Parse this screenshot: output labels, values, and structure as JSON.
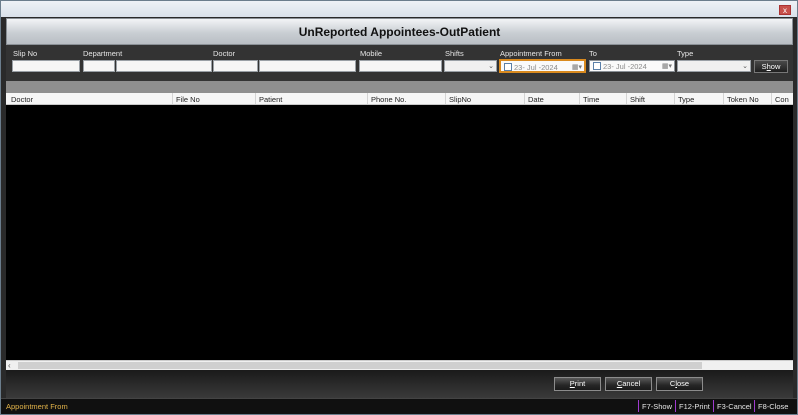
{
  "window": {
    "close_glyph": "x"
  },
  "title": "UnReported Appointees-OutPatient",
  "filters": {
    "slip_no_label": "Slip No",
    "department_label": "Department",
    "doctor_label": "Doctor",
    "mobile_label": "Mobile",
    "shifts_label": "Shifts",
    "appointment_from_label": "Appointment From",
    "to_label": "To",
    "type_label": "Type",
    "appointment_from_value": "23- Jul -2024",
    "to_value": "23- Jul -2024",
    "show_label_pre": "S",
    "show_label_u": "h",
    "show_label_post": "ow"
  },
  "grid": {
    "columns": [
      "Doctor",
      "File No",
      "Patient",
      "Phone No.",
      "SlipNo",
      "Date",
      "Time",
      "Shift",
      "Type",
      "Token No",
      "Con"
    ],
    "rows": []
  },
  "buttons": {
    "print_u": "P",
    "print_rest": "rint",
    "cancel_u": "C",
    "cancel_rest": "ancel",
    "close_pre": "C",
    "close_u": "l",
    "close_rest": "ose"
  },
  "status": {
    "focused_field": "Appointment From",
    "hints": [
      "F7-Show",
      "F12-Print",
      "F3-Cancel",
      "F8-Close"
    ]
  },
  "colors": {
    "focus_border": "#d98a1f",
    "status_text": "#e3b44a",
    "hint_separator": "#a03bd0"
  },
  "icons": [
    "close-icon",
    "checkbox-icon",
    "calendar-icon",
    "chevron-down-icon",
    "scroll-left-icon"
  ]
}
